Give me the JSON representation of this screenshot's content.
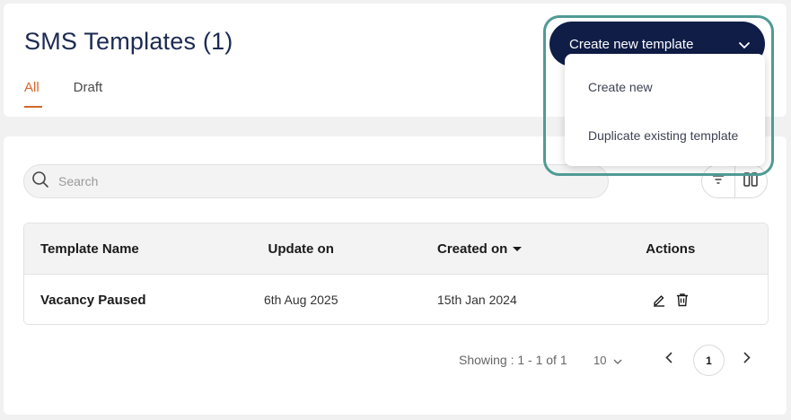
{
  "header": {
    "title": "SMS Templates (1)",
    "tabs": [
      {
        "label": "All",
        "active": true
      },
      {
        "label": "Draft",
        "active": false
      }
    ],
    "create_button": "Create new template",
    "dropdown": [
      "Create new",
      "Duplicate existing template"
    ]
  },
  "search": {
    "placeholder": "Search",
    "value": ""
  },
  "toolbar": {
    "icons": [
      "filter-icon",
      "columns-icon"
    ]
  },
  "table": {
    "columns": [
      "Template Name",
      "Update on",
      "Created on",
      "Actions"
    ],
    "sorted_column": "Created on",
    "rows": [
      {
        "name": "Vacancy Paused",
        "updated": "6th Aug 2025",
        "created": "15th Jan 2024",
        "actions": [
          "edit-icon",
          "delete-icon"
        ]
      }
    ]
  },
  "pagination": {
    "showing": "Showing : 1 - 1 of 1",
    "per_page": "10",
    "current_page": "1"
  },
  "colors": {
    "accent": "#d4672b",
    "primary": "#0f1d47",
    "highlight": "#4f9b94"
  }
}
